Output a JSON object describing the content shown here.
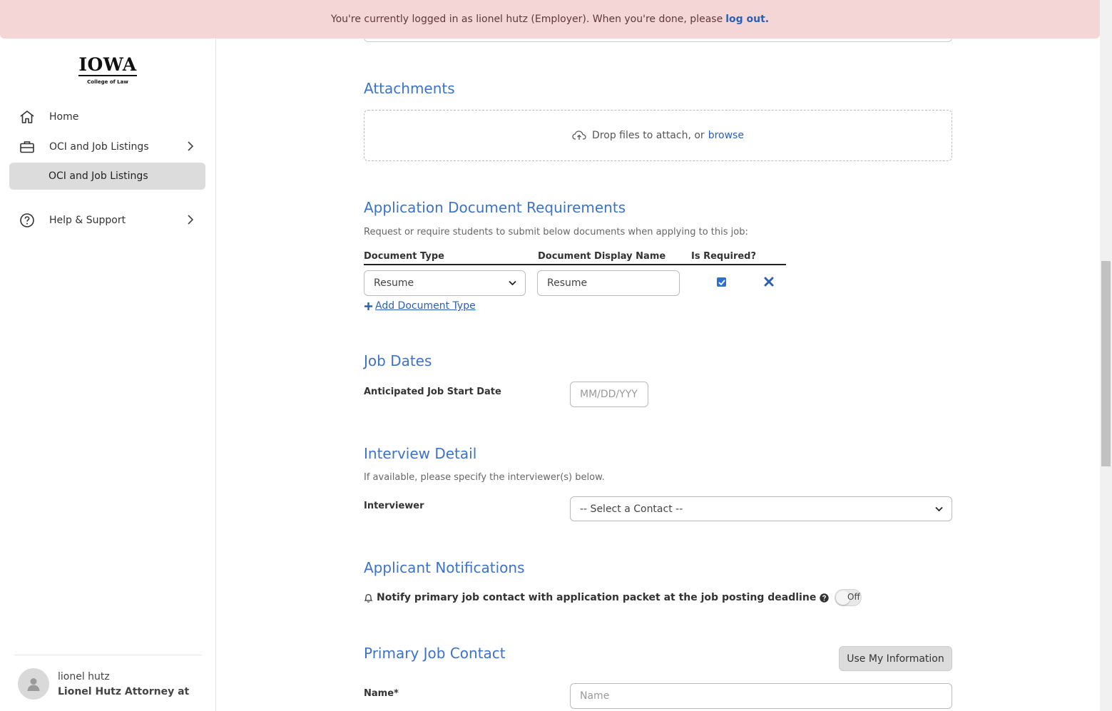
{
  "banner": {
    "text": "You're currently logged in as lionel hutz (Employer). When you're done, please",
    "logout_link": "log out."
  },
  "sidebar": {
    "logo": {
      "word": "IOWA",
      "sub": "College of Law"
    },
    "items": [
      {
        "label": "Home",
        "icon": "home-icon"
      },
      {
        "label": "OCI and Job Listings",
        "icon": "briefcase-icon"
      },
      {
        "label": "OCI and Job Listings",
        "selected": true
      },
      {
        "label": "Help & Support",
        "icon": "help-circle-icon"
      }
    ],
    "user": {
      "name": "lionel hutz",
      "org": "Lionel Hutz Attorney at L..."
    }
  },
  "attachments": {
    "title": "Attachments",
    "drop_text": "Drop files to attach, or",
    "browse_link": "browse"
  },
  "documents": {
    "title": "Application Document Requirements",
    "description": "Request or require students to submit below documents when applying to this job:",
    "headers": {
      "type": "Document Type",
      "display_name": "Document Display Name",
      "required": "Is Required?"
    },
    "rows": [
      {
        "type": "Resume",
        "display_name": "Resume",
        "required": true
      }
    ],
    "add_link": "Add Document Type"
  },
  "job_dates": {
    "title": "Job Dates",
    "start_label": "Anticipated Job Start Date",
    "start_placeholder": "MM/DD/YYY"
  },
  "interview": {
    "title": "Interview Detail",
    "description": "If available, please specify the interviewer(s) below.",
    "interviewer_label": "Interviewer",
    "interviewer_value": "-- Select a Contact --"
  },
  "notifications": {
    "title": "Applicant Notifications",
    "notify_label": "Notify primary job contact with application packet at the job posting deadline",
    "toggle_state": "Off"
  },
  "primary_contact": {
    "title": "Primary Job Contact",
    "use_my_info_button": "Use My Information",
    "name_label": "Name*",
    "name_placeholder": "Name"
  },
  "colors": {
    "accent": "#3c73c9",
    "link": "#2b5fb4",
    "banner_bg": "#f5d6d7",
    "selected_nav_bg": "#dcdcdc"
  }
}
